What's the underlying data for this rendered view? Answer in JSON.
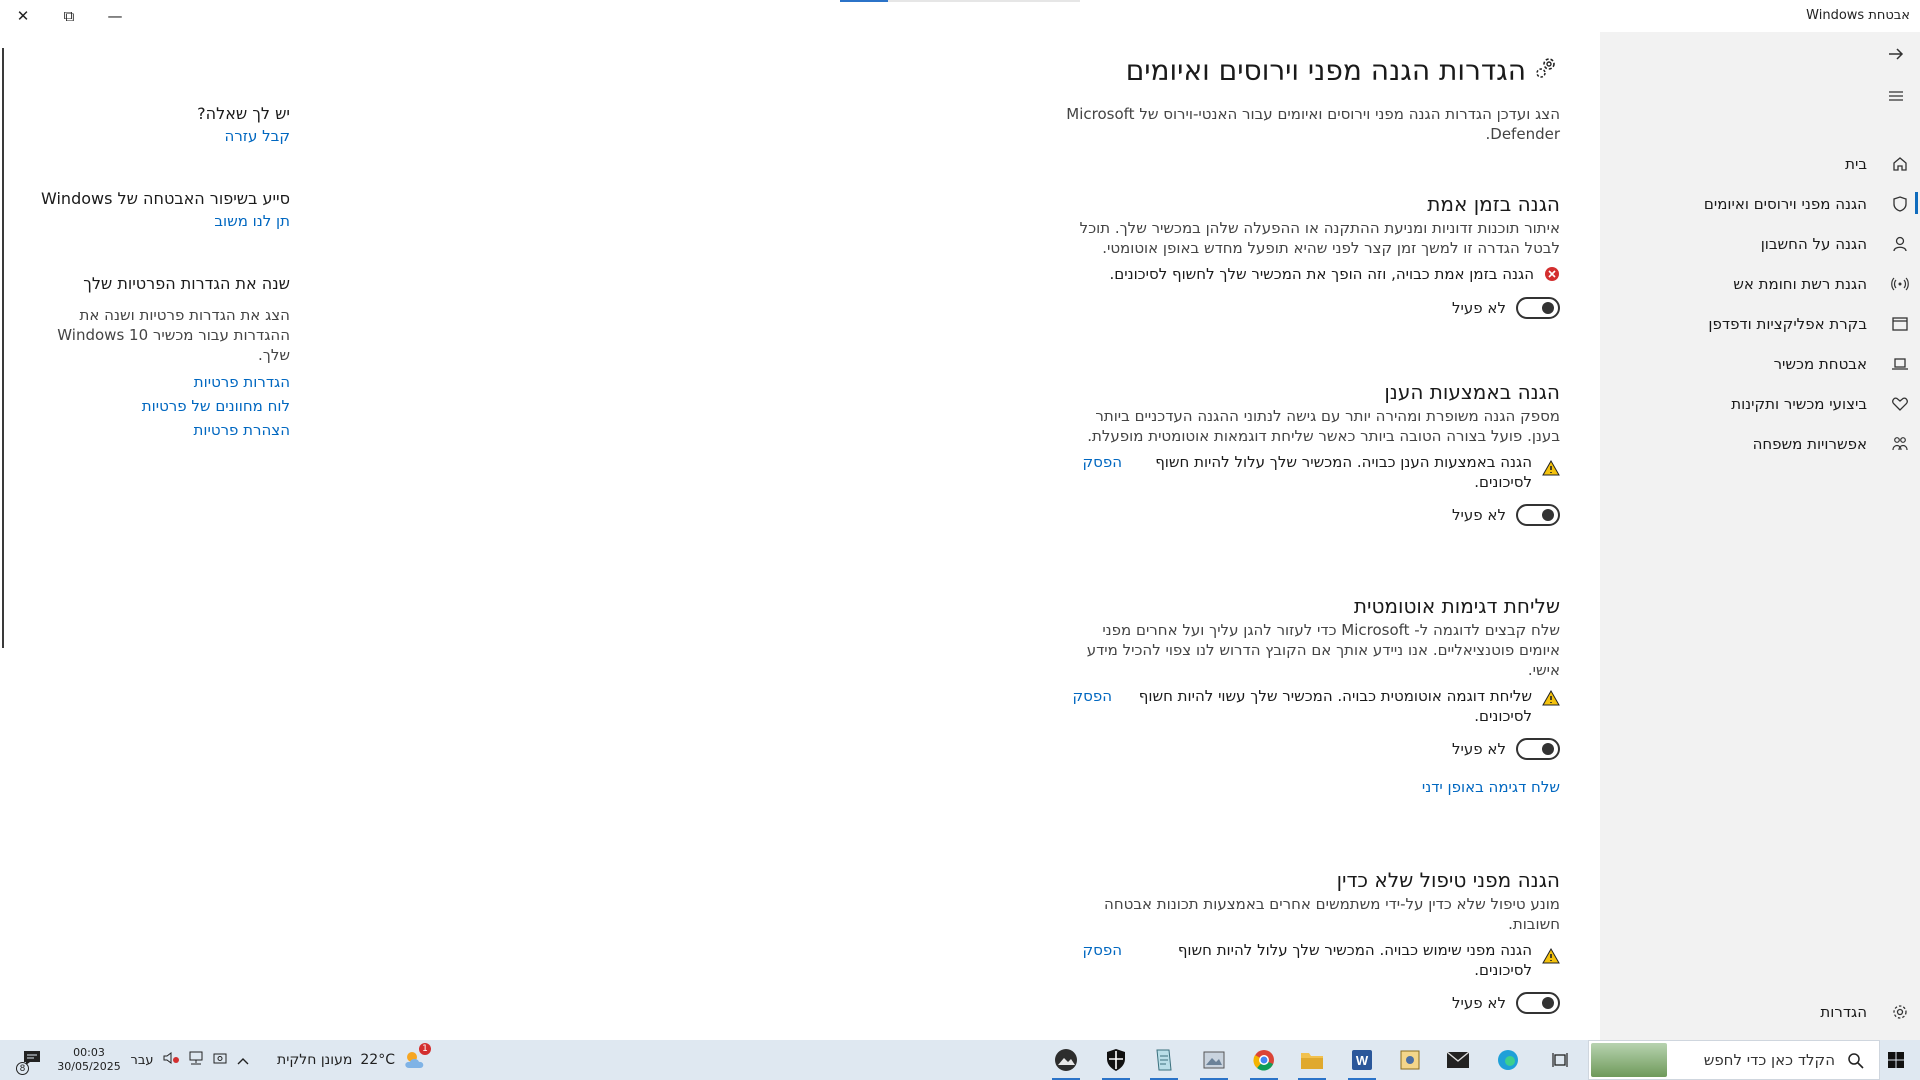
{
  "window": {
    "title": "אבטחת Windows",
    "close_glyph": "✕",
    "restore_glyph": "⧉",
    "minimize_glyph": "—"
  },
  "nav": {
    "back_icon": "arrow-right-icon",
    "menu_icon": "hamburger-icon",
    "items": [
      {
        "label": "בית",
        "icon": "home-icon"
      },
      {
        "label": "הגנה מפני וירוסים ואיומים",
        "icon": "shield-icon",
        "active": true
      },
      {
        "label": "הגנה על החשבון",
        "icon": "person-icon"
      },
      {
        "label": "הגנת רשת וחומת אש",
        "icon": "wifi-icon"
      },
      {
        "label": "בקרת אפליקציות ודפדפן",
        "icon": "app-window-icon"
      },
      {
        "label": "אבטחת מכשיר",
        "icon": "laptop-icon"
      },
      {
        "label": "ביצועי מכשיר ותקינות",
        "icon": "heart-icon"
      },
      {
        "label": "אפשרויות משפחה",
        "icon": "family-icon"
      }
    ],
    "settings": {
      "label": "הגדרות",
      "icon": "gear-icon"
    }
  },
  "main": {
    "title": "הגדרות הגנה מפני וירוסים ואיומים",
    "intro": "הצג ועדכן הגדרות הגנה מפני וירוסים ואיומים עבור האנטי-וירוס של Microsoft Defender.",
    "sections": [
      {
        "heading": "הגנה בזמן אמת",
        "description": "איתור תוכנות זדוניות ומניעת ההתקנה או ההפעלה שלהן במכשיר שלך. תוכל לבטל הגדרה זו למשך זמן קצר לפני שהיא תופעל מחדש באופן אוטומטי.",
        "status": "הגנה בזמן אמת כבויה, וזה הופך את המכשיר שלך לחשוף לסיכונים.",
        "status_level": "error",
        "action": "",
        "toggle_label": "לא פעיל",
        "toggle_on": false
      },
      {
        "heading": "הגנה באמצעות הענן",
        "description": "מספק הגנה משופרת ומהירה יותר עם גישה לנתוני ההגנה העדכניים ביותר בענן. פועל בצורה הטובה ביותר כאשר שליחת דוגמאות אוטומטית מופעלת.",
        "status": "הגנה באמצעות הענן כבויה. המכשיר שלך עלול להיות חשוף לסיכונים.",
        "status_level": "warning",
        "action": "הפסק",
        "toggle_label": "לא פעיל",
        "toggle_on": false
      },
      {
        "heading": "שליחת דגימות אוטומטית",
        "description": "שלח קבצים לדוגמה ל- Microsoft כדי לעזור להגן עליך ועל אחרים מפני איומים פוטנציאליים. אנו ניידע אותך אם הקובץ הדרוש לנו צפוי להכיל מידע אישי.",
        "status": "שליחת דוגמה אוטומטית כבויה. המכשיר שלך עשוי להיות חשוף לסיכונים.",
        "status_level": "warning",
        "action": "הפסק",
        "toggle_label": "לא פעיל",
        "toggle_on": false,
        "extra_link": "שלח דגימה באופן ידני"
      },
      {
        "heading": "הגנה מפני טיפול שלא כדין",
        "description": "מונע טיפול שלא כדין על-ידי משתמשים אחרים באמצעות תכונות אבטחה חשובות.",
        "status": "הגנה מפני שימוש כבויה. המכשיר שלך עלול להיות חשוף לסיכונים.",
        "status_level": "warning",
        "action": "הפסק",
        "toggle_label": "לא פעיל",
        "toggle_on": false
      }
    ]
  },
  "side": {
    "question_heading": "יש לך שאלה?",
    "help_link": "קבל עזרה",
    "improve_heading": "סייע בשיפור האבטחה של Windows",
    "feedback_link": "תן לנו משוב",
    "privacy_heading": "שנה את הגדרות הפרטיות שלך",
    "privacy_text": "הצג את הגדרות פרטיות ושנה את ההגדרות עבור מכשיר Windows 10 שלך.",
    "privacy_links": [
      "הגדרות פרטיות",
      "לוח מחוונים של פרטיות",
      "הצהרת פרטיות"
    ]
  },
  "taskbar": {
    "search_placeholder": "הקלד כאן כדי לחפש",
    "weather_temp": "22°C",
    "weather_text": "מעונן חלקית",
    "weather_badge": "1",
    "language": "עבר",
    "time": "00:03",
    "date": "30/05/2025",
    "notification_count": "8",
    "apps": [
      "windows-start-icon",
      "task-view-icon",
      "edge-icon",
      "mail-icon",
      "explorer-tool-icon",
      "word-icon",
      "file-explorer-icon",
      "chrome-icon",
      "image-viewer-icon",
      "notepad-icon",
      "windows-security-icon",
      "photos-icon"
    ]
  }
}
